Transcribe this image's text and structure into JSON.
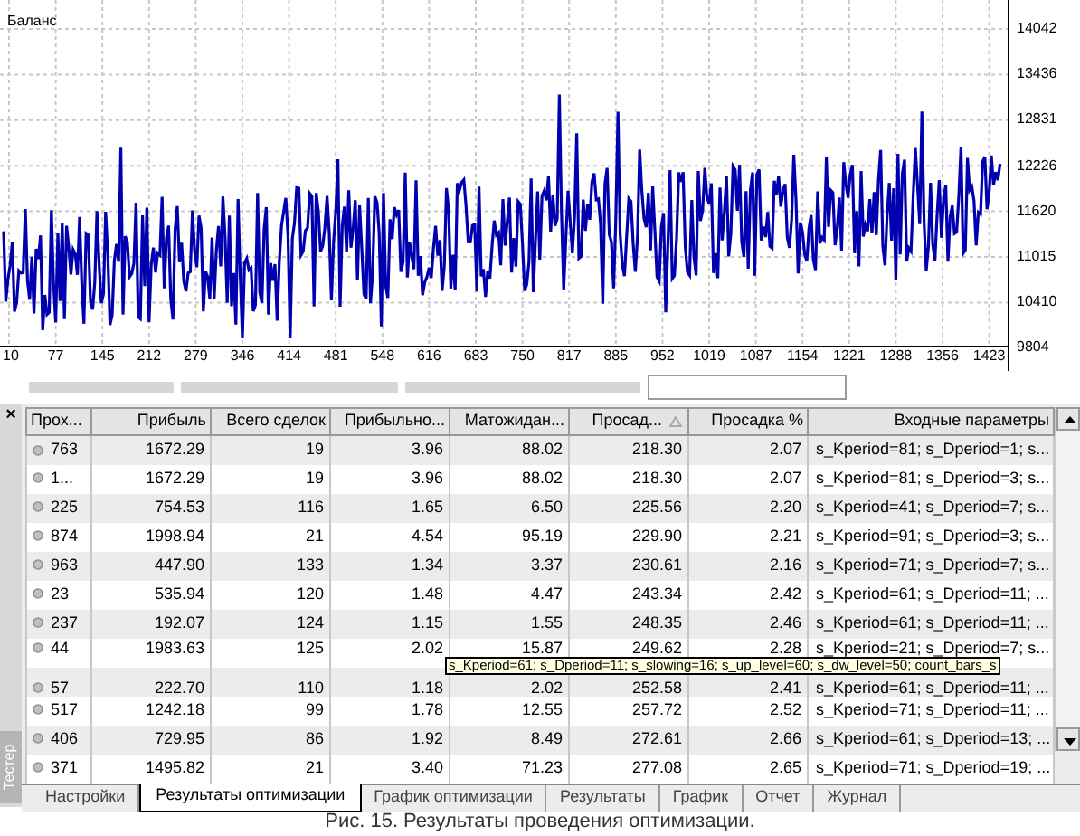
{
  "chart": {
    "title": "Баланс",
    "y_labels": [
      "14042",
      "13436",
      "12831",
      "12226",
      "11620",
      "11015",
      "10410",
      "9804"
    ],
    "x_labels": [
      "10",
      "77",
      "145",
      "212",
      "279",
      "346",
      "414",
      "481",
      "548",
      "616",
      "683",
      "750",
      "817",
      "885",
      "952",
      "1019",
      "1087",
      "1154",
      "1221",
      "1288",
      "1356",
      "1423"
    ]
  },
  "panel": {
    "close": "×",
    "title": "Тестер"
  },
  "table": {
    "columns": [
      {
        "label": "Прох...",
        "sorted": false
      },
      {
        "label": "Прибыль",
        "sorted": false
      },
      {
        "label": "Всего сделок",
        "sorted": false
      },
      {
        "label": "Прибыльно...",
        "sorted": false
      },
      {
        "label": "Матожидан...",
        "sorted": false
      },
      {
        "label": "Просад...",
        "sorted": true
      },
      {
        "label": "Просадка %",
        "sorted": false
      },
      {
        "label": "Входные параметры",
        "sorted": false
      }
    ],
    "rows": [
      [
        "763",
        "1672.29",
        "19",
        "3.96",
        "88.02",
        "218.30",
        "2.07",
        "s_Kperiod=81; s_Dperiod=1; s..."
      ],
      [
        "1...",
        "1672.29",
        "19",
        "3.96",
        "88.02",
        "218.30",
        "2.07",
        "s_Kperiod=81; s_Dperiod=3; s..."
      ],
      [
        "225",
        "754.53",
        "116",
        "1.65",
        "6.50",
        "225.56",
        "2.20",
        "s_Kperiod=41; s_Dperiod=7; s..."
      ],
      [
        "874",
        "1998.94",
        "21",
        "4.54",
        "95.19",
        "229.90",
        "2.21",
        "s_Kperiod=91; s_Dperiod=3; s..."
      ],
      [
        "963",
        "447.90",
        "133",
        "1.34",
        "3.37",
        "230.61",
        "2.16",
        "s_Kperiod=71; s_Dperiod=7; s..."
      ],
      [
        "23",
        "535.94",
        "120",
        "1.48",
        "4.47",
        "243.34",
        "2.42",
        "s_Kperiod=61; s_Dperiod=11; ..."
      ],
      [
        "237",
        "192.07",
        "124",
        "1.15",
        "1.55",
        "248.35",
        "2.46",
        "s_Kperiod=61; s_Dperiod=11; ..."
      ],
      [
        "44",
        "1983.63",
        "125",
        "2.02",
        "15.87",
        "249.62",
        "2.28",
        "s_Kperiod=21; s_Dperiod=7; s..."
      ],
      [
        "57",
        "222.70",
        "110",
        "1.18",
        "2.02",
        "252.58",
        "2.41",
        "s_Kperiod=61; s_Dperiod=11; ..."
      ],
      [
        "517",
        "1242.18",
        "99",
        "1.78",
        "12.55",
        "257.72",
        "2.52",
        "s_Kperiod=71; s_Dperiod=11; ..."
      ],
      [
        "406",
        "729.95",
        "86",
        "1.92",
        "8.49",
        "272.61",
        "2.66",
        "s_Kperiod=61; s_Dperiod=13; ..."
      ],
      [
        "371",
        "1495.82",
        "21",
        "3.40",
        "71.23",
        "277.08",
        "2.65",
        "s_Kperiod=71; s_Dperiod=19; ..."
      ]
    ]
  },
  "tooltip": "s_Kperiod=61; s_Dperiod=11; s_slowing=16; s_up_level=60; s_dw_level=50; count_bars_s",
  "tabs": [
    {
      "label": "Настройки",
      "selected": false
    },
    {
      "label": "Результаты оптимизации",
      "selected": true
    },
    {
      "label": "График оптимизации",
      "selected": false
    },
    {
      "label": "Результаты",
      "selected": false
    },
    {
      "label": "График",
      "selected": false
    },
    {
      "label": "Отчет",
      "selected": false
    },
    {
      "label": "Журнал",
      "selected": false
    }
  ],
  "caption": "Рис. 15. Результаты проведения оптимизации."
}
